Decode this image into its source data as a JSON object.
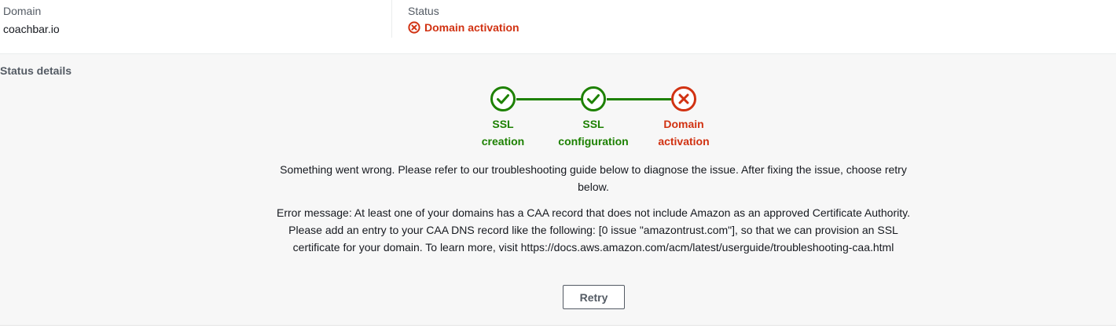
{
  "summary": {
    "domain_label": "Domain",
    "domain_value": "coachbar.io",
    "status_label": "Status",
    "status_value": "Domain activation",
    "status_icon": "error-circle-icon"
  },
  "details": {
    "title": "Status details",
    "steps": [
      {
        "line1": "SSL",
        "line2": "creation",
        "state": "completed",
        "icon": "check-circle-icon"
      },
      {
        "line1": "SSL",
        "line2": "configuration",
        "state": "completed",
        "icon": "check-circle-icon"
      },
      {
        "line1": "Domain",
        "line2": "activation",
        "state": "failed",
        "icon": "error-circle-icon"
      }
    ],
    "message": "Something went wrong. Please refer to our troubleshooting guide below to diagnose the issue. After fixing the issue, choose retry below.",
    "error_message": "Error message: At least one of your domains has a CAA record that does not include Amazon as an approved Certificate Authority. Please add an entry to your CAA DNS record like the following: [0 issue \"amazontrust.com\"], so that we can provision an SSL certificate for your domain. To learn more, visit https://docs.aws.amazon.com/acm/latest/userguide/troubleshooting-caa.html",
    "retry_label": "Retry"
  },
  "colors": {
    "success": "#1d8102",
    "error": "#d13212",
    "panel_background": "#f7f7f7"
  }
}
